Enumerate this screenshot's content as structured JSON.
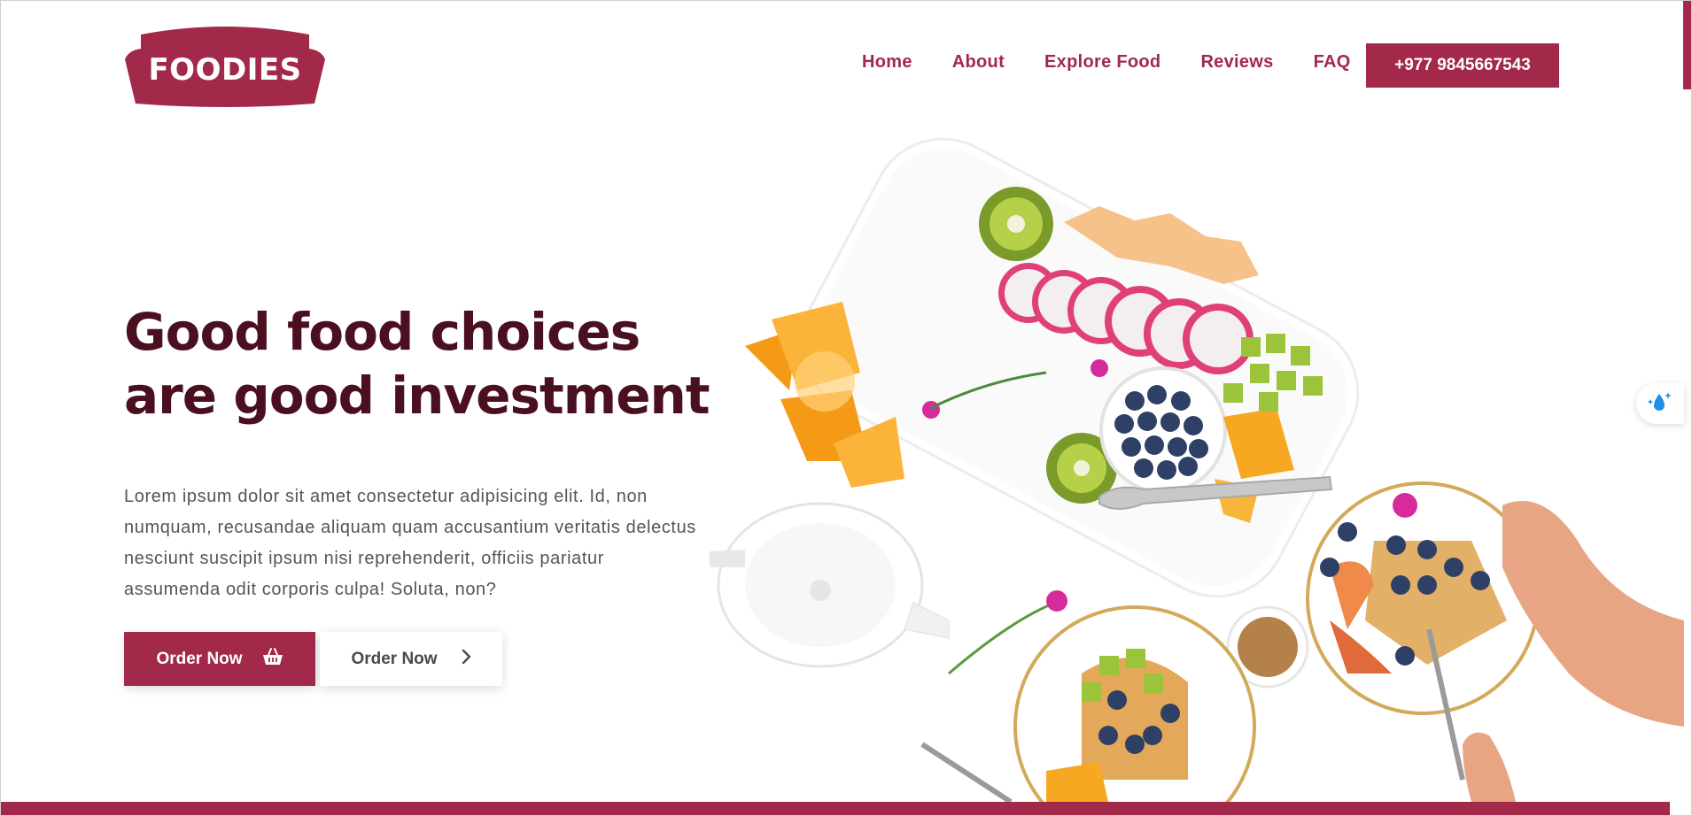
{
  "brand": {
    "logo_text": "FOODIES",
    "color": "#a2294a",
    "dark_color": "#4a1020"
  },
  "nav": {
    "items": [
      {
        "label": "Home"
      },
      {
        "label": "About"
      },
      {
        "label": "Explore Food"
      },
      {
        "label": "Reviews"
      },
      {
        "label": "FAQ"
      }
    ],
    "phone": "+977 9845667543"
  },
  "hero": {
    "title": "Good food choices are good investment",
    "description": "Lorem ipsum dolor sit amet consectetur adipisicing elit. Id, non numquam, recusandae aliquam quam accusantium veritatis delectus nesciunt suscipit ipsum nisi reprehenderit, officiis pariatur assumenda odit corporis culpa! Soluta, non?",
    "primary_button": {
      "label": "Order Now",
      "icon": "basket-icon"
    },
    "secondary_button": {
      "label": "Order Now",
      "icon": "chevron-right-icon"
    }
  },
  "side_widget": {
    "icon": "water-drop-sparkle-icon"
  }
}
